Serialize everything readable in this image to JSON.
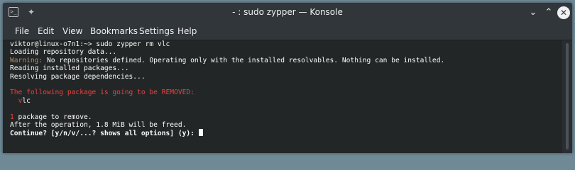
{
  "window": {
    "title": "- : sudo zypper — Konsole",
    "app_icon": ">_",
    "pin_icon": "✦",
    "minimize_icon": "⌄",
    "maximize_icon": "⌃",
    "close_icon": "✕"
  },
  "menubar": {
    "items": [
      "File",
      "Edit",
      "View",
      "Bookmarks",
      "Settings",
      "Help"
    ]
  },
  "terminal": {
    "line1": "viktor@linux-o7n1:~> sudo zypper rm vlc",
    "line2": "Loading repository data...",
    "line3_warn": "Warning:",
    "line3_text": " No repositories defined. Operating only with the installed resolvables. Nothing can be installed.",
    "line4": "Reading installed packages...",
    "line5": "Resolving package dependencies...",
    "line6": "",
    "line7": "The following package is going to be REMOVED:",
    "line8_prefix": "  ",
    "line8_pkg_first": "v",
    "line8_pkg_rest": "lc",
    "line9": "",
    "line10_num": "1",
    "line10_text": " package to remove.",
    "line11": "After the operation, 1.8 MiB will be freed.",
    "line12": "Continue? [y/n/v/...? shows all options] (y): "
  },
  "colors": {
    "warning": "#b08c60",
    "removed": "#e8423f",
    "background": "#232627"
  }
}
